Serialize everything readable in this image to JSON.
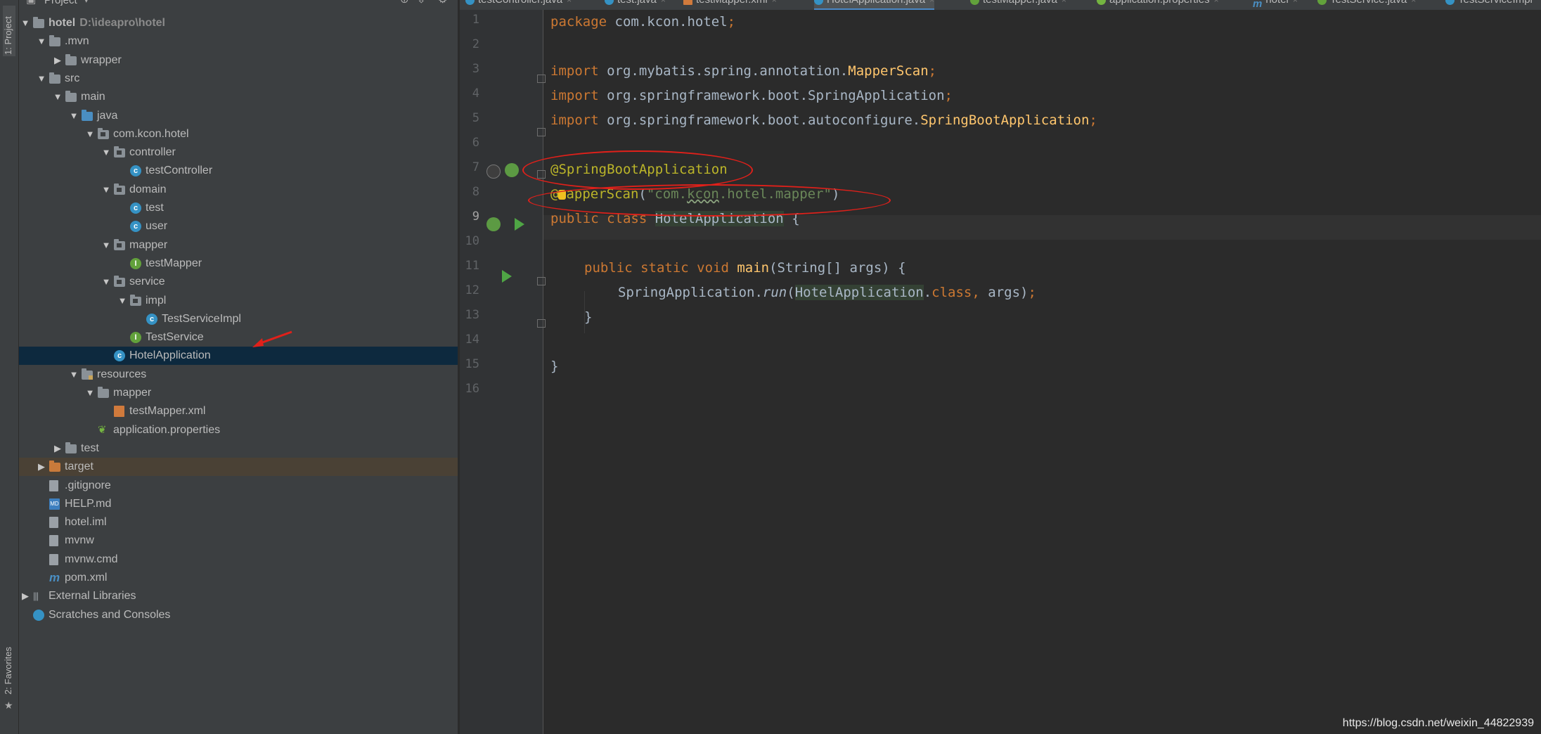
{
  "side_strip": {
    "project_tab": "1: Project",
    "favorites_tab": "2: Favorites"
  },
  "project_panel": {
    "title": "Project",
    "tree": [
      {
        "label": "hotel",
        "path": "D:\\ideapro\\hotel",
        "depth": 0,
        "expanded": true,
        "icon": "module-folder-icon",
        "bold": true
      },
      {
        "label": ".mvn",
        "depth": 1,
        "expanded": true,
        "icon": "folder-icon"
      },
      {
        "label": "wrapper",
        "depth": 2,
        "expanded": false,
        "icon": "folder-icon"
      },
      {
        "label": "src",
        "depth": 1,
        "expanded": true,
        "icon": "folder-icon"
      },
      {
        "label": "main",
        "depth": 2,
        "expanded": true,
        "icon": "folder-icon"
      },
      {
        "label": "java",
        "depth": 3,
        "expanded": true,
        "icon": "source-folder-icon"
      },
      {
        "label": "com.kcon.hotel",
        "depth": 4,
        "expanded": true,
        "icon": "package-icon"
      },
      {
        "label": "controller",
        "depth": 5,
        "expanded": true,
        "icon": "package-icon"
      },
      {
        "label": "testController",
        "depth": 6,
        "icon": "class-icon"
      },
      {
        "label": "domain",
        "depth": 5,
        "expanded": true,
        "icon": "package-icon"
      },
      {
        "label": "test",
        "depth": 6,
        "icon": "class-icon"
      },
      {
        "label": "user",
        "depth": 6,
        "icon": "class-icon"
      },
      {
        "label": "mapper",
        "depth": 5,
        "expanded": true,
        "icon": "package-icon"
      },
      {
        "label": "testMapper",
        "depth": 6,
        "icon": "interface-icon"
      },
      {
        "label": "service",
        "depth": 5,
        "expanded": true,
        "icon": "package-icon"
      },
      {
        "label": "impl",
        "depth": 6,
        "expanded": true,
        "icon": "package-icon"
      },
      {
        "label": "TestServiceImpl",
        "depth": 7,
        "icon": "class-icon"
      },
      {
        "label": "TestService",
        "depth": 6,
        "icon": "interface-icon"
      },
      {
        "label": "HotelApplication",
        "depth": 5,
        "icon": "spring-boot-class-icon",
        "selected": true
      },
      {
        "label": "resources",
        "depth": 3,
        "expanded": true,
        "icon": "resources-folder-icon"
      },
      {
        "label": "mapper",
        "depth": 4,
        "expanded": true,
        "icon": "folder-icon"
      },
      {
        "label": "testMapper.xml",
        "depth": 5,
        "icon": "xml-file-icon"
      },
      {
        "label": "application.properties",
        "depth": 4,
        "icon": "spring-properties-icon"
      },
      {
        "label": "test",
        "depth": 2,
        "expanded": false,
        "icon": "folder-icon"
      },
      {
        "label": "target",
        "depth": 1,
        "expanded": false,
        "icon": "excluded-folder-icon",
        "highlight": true
      },
      {
        "label": ".gitignore",
        "depth": 1,
        "icon": "text-file-icon"
      },
      {
        "label": "HELP.md",
        "depth": 1,
        "icon": "markdown-file-icon"
      },
      {
        "label": "hotel.iml",
        "depth": 1,
        "icon": "text-file-icon"
      },
      {
        "label": "mvnw",
        "depth": 1,
        "icon": "text-file-icon"
      },
      {
        "label": "mvnw.cmd",
        "depth": 1,
        "icon": "text-file-icon"
      },
      {
        "label": "pom.xml",
        "depth": 1,
        "icon": "maven-icon"
      },
      {
        "label": "External Libraries",
        "depth": 0,
        "expanded": false,
        "icon": "libraries-icon"
      },
      {
        "label": "Scratches and Consoles",
        "depth": 0,
        "icon": "scratches-icon"
      }
    ]
  },
  "editor_tabs": [
    {
      "label": "testController.java",
      "icon": "class-icon"
    },
    {
      "label": "test.java",
      "icon": "class-icon"
    },
    {
      "label": "testMapper.xml",
      "icon": "xml-file-icon"
    },
    {
      "label": "HotelApplication.java",
      "icon": "class-icon",
      "active": true
    },
    {
      "label": "testMapper.java",
      "icon": "interface-icon"
    },
    {
      "label": "application.properties",
      "icon": "spring-properties-icon"
    },
    {
      "label": "hotel",
      "icon": "maven-icon"
    },
    {
      "label": "TestService.java",
      "icon": "interface-icon"
    },
    {
      "label": "TestServiceImpl",
      "icon": "class-icon"
    }
  ],
  "editor": {
    "line_numbers": [
      "1",
      "2",
      "3",
      "4",
      "5",
      "6",
      "7",
      "8",
      "9",
      "10",
      "11",
      "12",
      "13",
      "14",
      "15",
      "16"
    ],
    "current_line": "9",
    "code": {
      "l1_kw": "package",
      "l1_rest": " com.kcon.hotel",
      "l1_semi": ";",
      "l3_kw": "import",
      "l3_pkg": " org.mybatis.spring.annotation.",
      "l3_cls": "MapperScan",
      "l4_kw": "import",
      "l4_pkg": " org.springframework.boot.SpringApplication",
      "l5_kw": "import",
      "l5_pkg": " org.springframework.boot.autoconfigure.",
      "l5_cls": "SpringBootApplication",
      "l7_ann": "@SpringBootApplication",
      "l8_at": "@",
      "l8_ann": "apperScan",
      "l8_paren_open": "(",
      "l8_str_a": "\"com.",
      "l8_str_b": "kcon",
      "l8_str_c": ".hotel.mapper\"",
      "l8_paren_close": ")",
      "l9_kw": "public class ",
      "l9_name": "HotelApplication",
      "l9_brace": " {",
      "l11_kw": "public static void ",
      "l11_fn": "main",
      "l11_rest": "(String[] args) {",
      "l12_obj": "SpringApplication.",
      "l12_fn": "run",
      "l12_paren": "(",
      "l12_cls": "HotelApplication",
      "l12_dot": ".",
      "l12_kw": "class",
      "l12_comma": ", ",
      "l12_args": "args)",
      "l12_semi": ";",
      "l13": "}",
      "l15": "}"
    }
  },
  "watermark": "https://blog.csdn.net/weixin_44822939",
  "colors": {
    "panel_bg": "#3c3f41",
    "editor_bg": "#2b2b2b",
    "selection": "#0d293e",
    "keyword": "#cc7832",
    "annotation": "#bbb529",
    "string": "#6a8759",
    "markup_red": "#e0201a"
  }
}
